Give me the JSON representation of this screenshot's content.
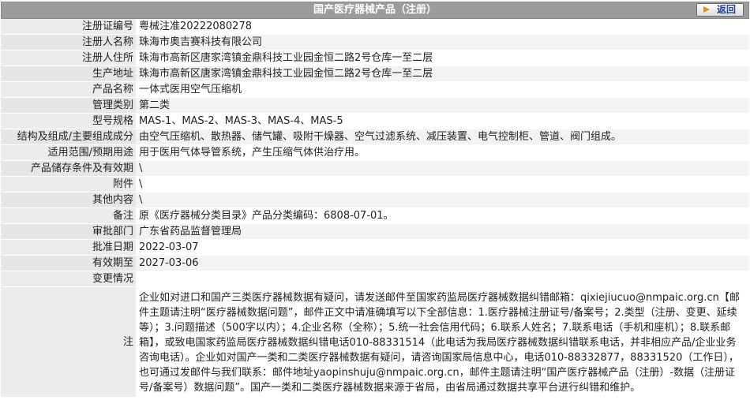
{
  "header": {
    "title": "国产医疗器械产品（注册）",
    "back_label": "返回"
  },
  "rows": [
    {
      "label": "注册证编号",
      "value": "粤械注准20222080278"
    },
    {
      "label": "注册人名称",
      "value": "珠海市奥吉赛科技有限公司"
    },
    {
      "label": "注册人住所",
      "value": "珠海市高新区唐家湾镇金鼎科技工业园金恒二路2号仓库一至二层"
    },
    {
      "label": "生产地址",
      "value": "珠海市高新区唐家湾镇金鼎科技工业园金恒二路2号仓库一至二层"
    },
    {
      "label": "产品名称",
      "value": "一体式医用空气压缩机"
    },
    {
      "label": "管理类别",
      "value": "第二类"
    },
    {
      "label": "型号规格",
      "value": "MAS-1、MAS-2、MAS-3、MAS-4、MAS-5"
    },
    {
      "label": "结构及组成/主要组成成分",
      "value": "由空气压缩机、散热器、储气罐、吸附干燥器、空气过滤系统、减压装置、电气控制柜、管道、阀门组成。"
    },
    {
      "label": "适用范围/预期用途",
      "value": "用于医用气体导管系统，产生压缩气体供治疗用。"
    },
    {
      "label": "产品储存条件及有效期",
      "value": "\\"
    },
    {
      "label": "附件",
      "value": "\\"
    },
    {
      "label": "其他内容",
      "value": "\\"
    },
    {
      "label": "备注",
      "value": "原《医疗器械分类目录》产品分类编码：6808-07-01。"
    },
    {
      "label": "审批部门",
      "value": "广东省药品监督管理局"
    },
    {
      "label": "批准日期",
      "value": "2022-03-07"
    },
    {
      "label": "有效期至",
      "value": "2027-03-06"
    },
    {
      "label": "变更情况",
      "value": ""
    }
  ],
  "note": {
    "label": "注",
    "text": "企业如对进口和国产三类医疗器械数据有疑问，请发送邮件至国家药监局医疗器械数据纠错邮箱：qixiejiucuo@nmpaic.org.cn【邮件主题请注明“医疗器械数据问题”，邮件正文中请准确填写以下全部信息：1.医疗器械注册证号/备案号；2.类型（注册、变更、延续等）；3.问题描述（500字以内）；4.企业名称（全称）；5.统一社会信用代码；6.联系人姓名；7.联系电话（手机和座机）；8.联系邮箱】，或致电国家药监局医疗器械数据纠错电话010-88331514（此电话为我局医疗器械数据纠错联系电话，并非相应产品/企业业务咨询电话）。企业如对国产一类和二类医疗器械数据有疑问，请咨询国家局信息中心，电话010-88332877，88331520（工作日），也可通过发邮件与我们联系：邮件地址yaopinshuju@nmpaic.org.cn，邮件主题请注明“国产医疗器械产品（注册）-数据（注册证号/备案号）数据问题”。国产一类和二类医疗器械数据来源于省局，由省局通过数据共享平台进行纠错和维护。"
  }
}
